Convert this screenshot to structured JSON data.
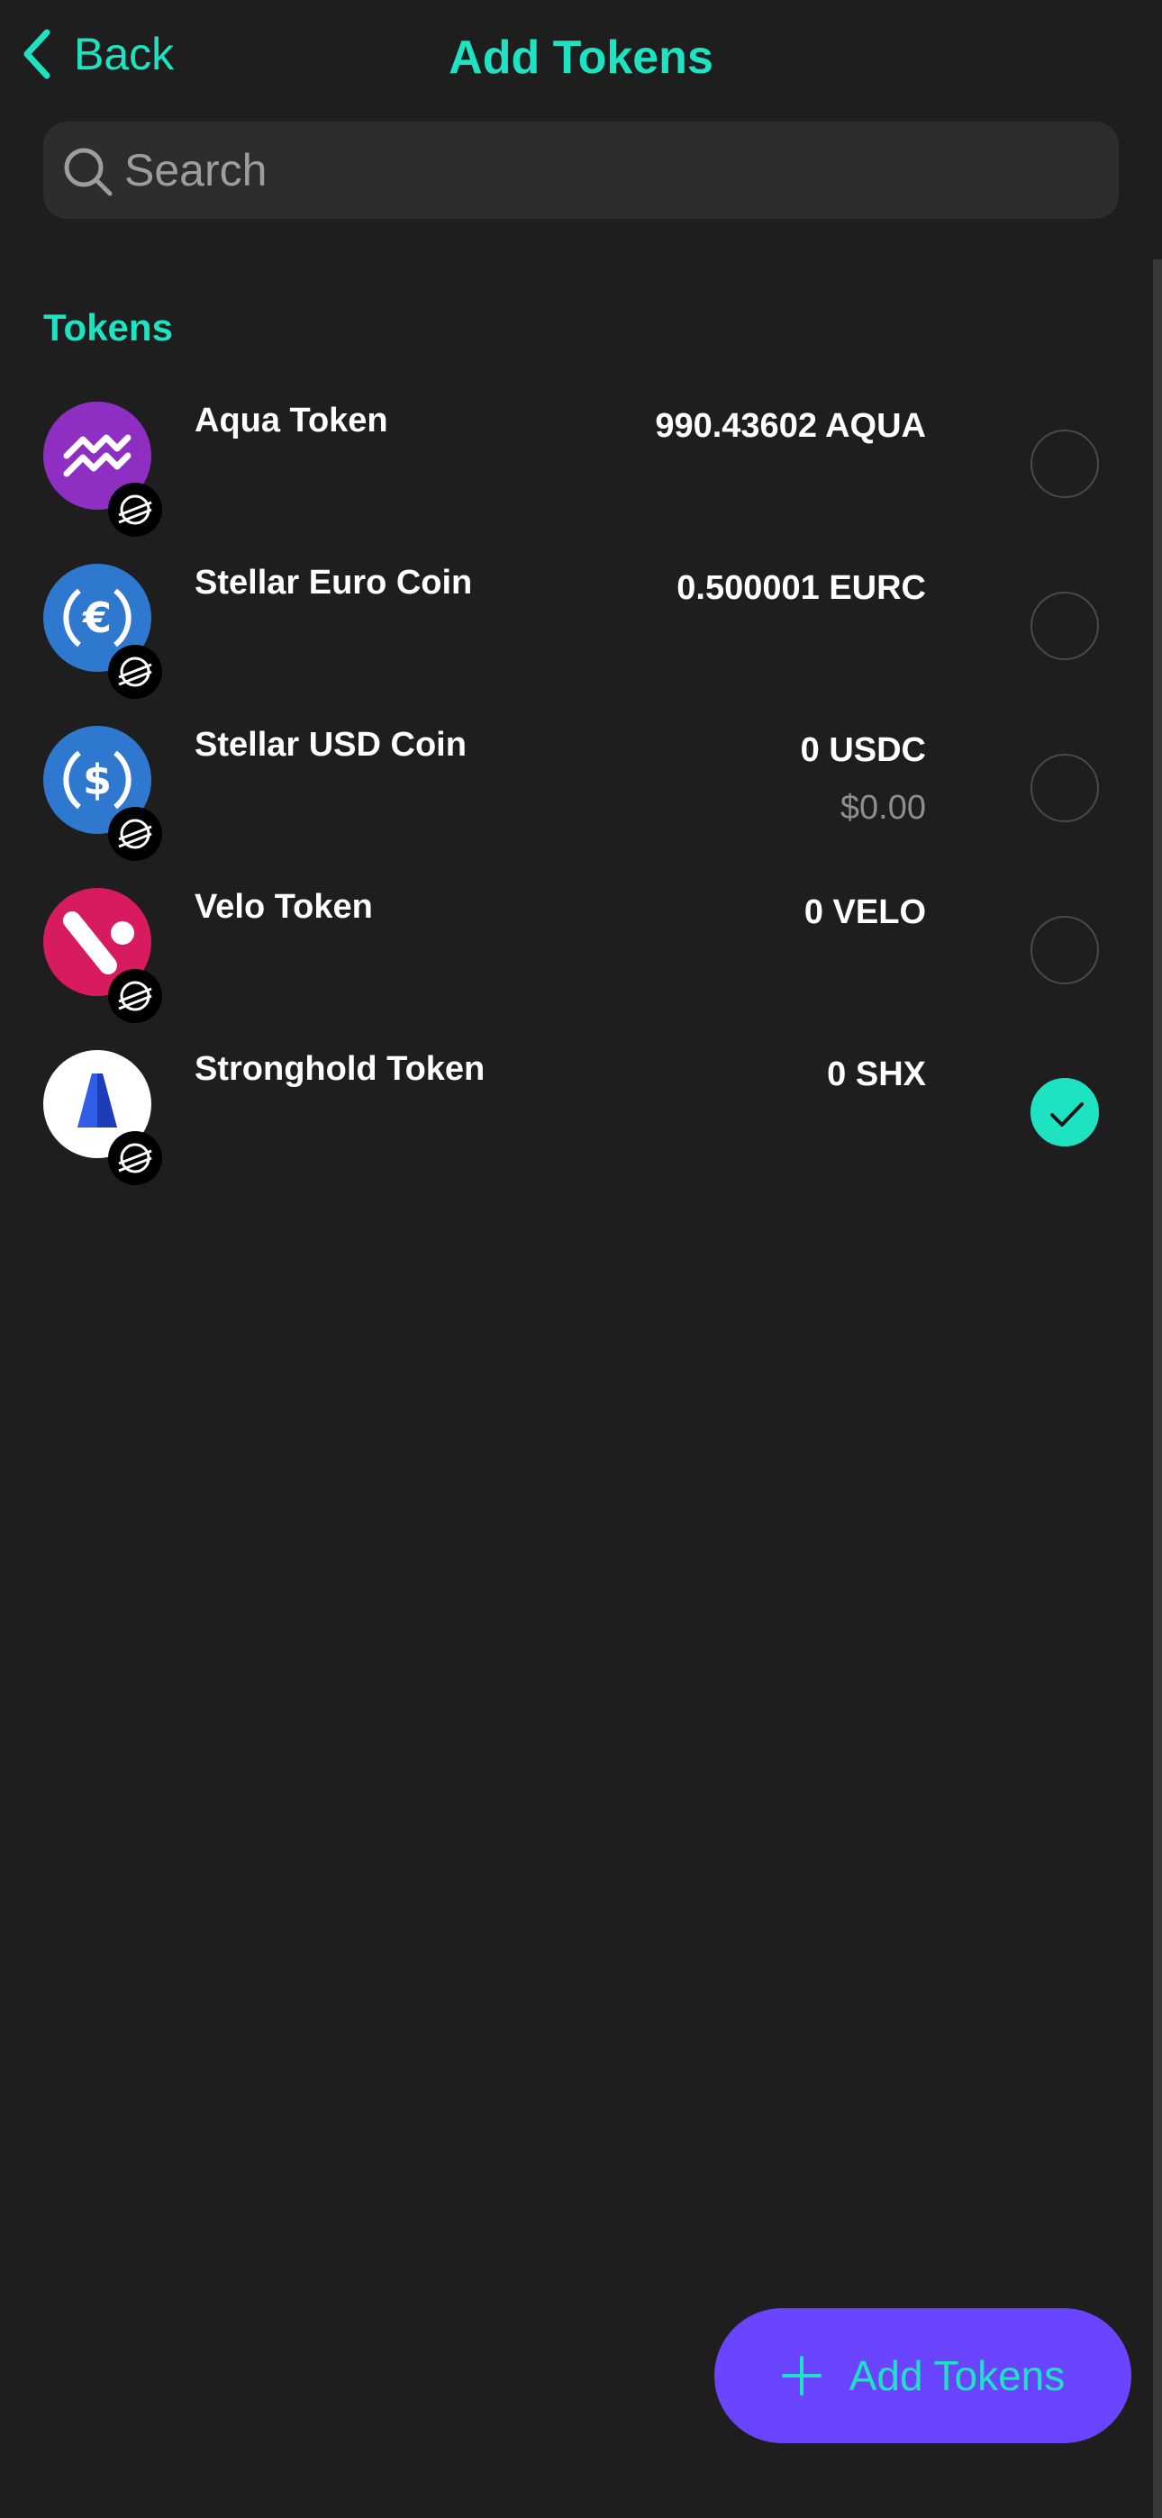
{
  "header": {
    "back_label": "Back",
    "title": "Add Tokens"
  },
  "search": {
    "placeholder": "Search",
    "value": ""
  },
  "section_title": "Tokens",
  "tokens": [
    {
      "name": "Aqua Token",
      "balance": "990.43602 AQUA",
      "fiat": "",
      "selected": false,
      "logo_icon": "aqua-logo-icon",
      "color": "#8e2ec3"
    },
    {
      "name": "Stellar Euro Coin",
      "balance": "0.500001 EURC",
      "fiat": "",
      "selected": false,
      "logo_icon": "euro-coin-logo-icon",
      "color": "#2f78d0"
    },
    {
      "name": "Stellar USD Coin",
      "balance": "0 USDC",
      "fiat": "$0.00",
      "selected": false,
      "logo_icon": "usd-coin-logo-icon",
      "color": "#2f78d0"
    },
    {
      "name": "Velo Token",
      "balance": "0 VELO",
      "fiat": "",
      "selected": false,
      "logo_icon": "velo-logo-icon",
      "color": "#d81b60"
    },
    {
      "name": "Stronghold Token",
      "balance": "0 SHX",
      "fiat": "",
      "selected": true,
      "logo_icon": "stronghold-logo-icon",
      "color": "#1d3db8"
    }
  ],
  "fab": {
    "label": "Add Tokens"
  },
  "colors": {
    "accent": "#1ee3c3",
    "button": "#6a44ff",
    "background": "#1e1e1e"
  }
}
